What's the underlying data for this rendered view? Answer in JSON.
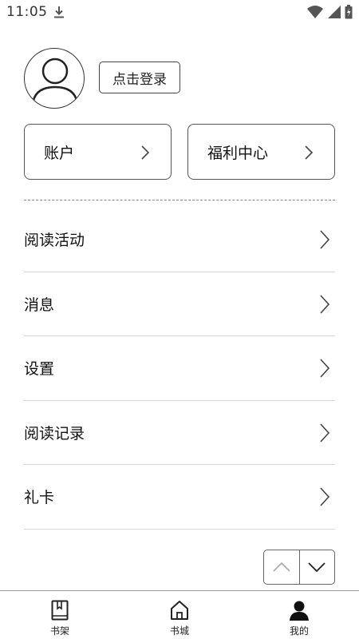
{
  "status_bar": {
    "time": "11:05",
    "icons": [
      "download-icon",
      "wifi-icon",
      "cell-signal-icon",
      "battery-icon"
    ]
  },
  "profile": {
    "avatar_icon": "user-avatar-icon",
    "login_label": "点击登录"
  },
  "cards": {
    "account_label": "账户",
    "welfare_label": "福利中心"
  },
  "menu": {
    "items": [
      {
        "label": "阅读活动"
      },
      {
        "label": "消息"
      },
      {
        "label": "设置"
      },
      {
        "label": "阅读记录"
      },
      {
        "label": "礼卡"
      }
    ]
  },
  "scroll_controls": {
    "up_icon": "chevron-up-icon",
    "down_icon": "chevron-down-icon"
  },
  "bottom_nav": {
    "items": [
      {
        "label": "书架",
        "icon": "bookshelf-icon",
        "active": false
      },
      {
        "label": "书城",
        "icon": "home-icon",
        "active": false
      },
      {
        "label": "我的",
        "icon": "person-icon",
        "active": true
      }
    ]
  },
  "colors": {
    "text": "#111111",
    "border": "#555555",
    "divider": "#d8d8d8"
  }
}
